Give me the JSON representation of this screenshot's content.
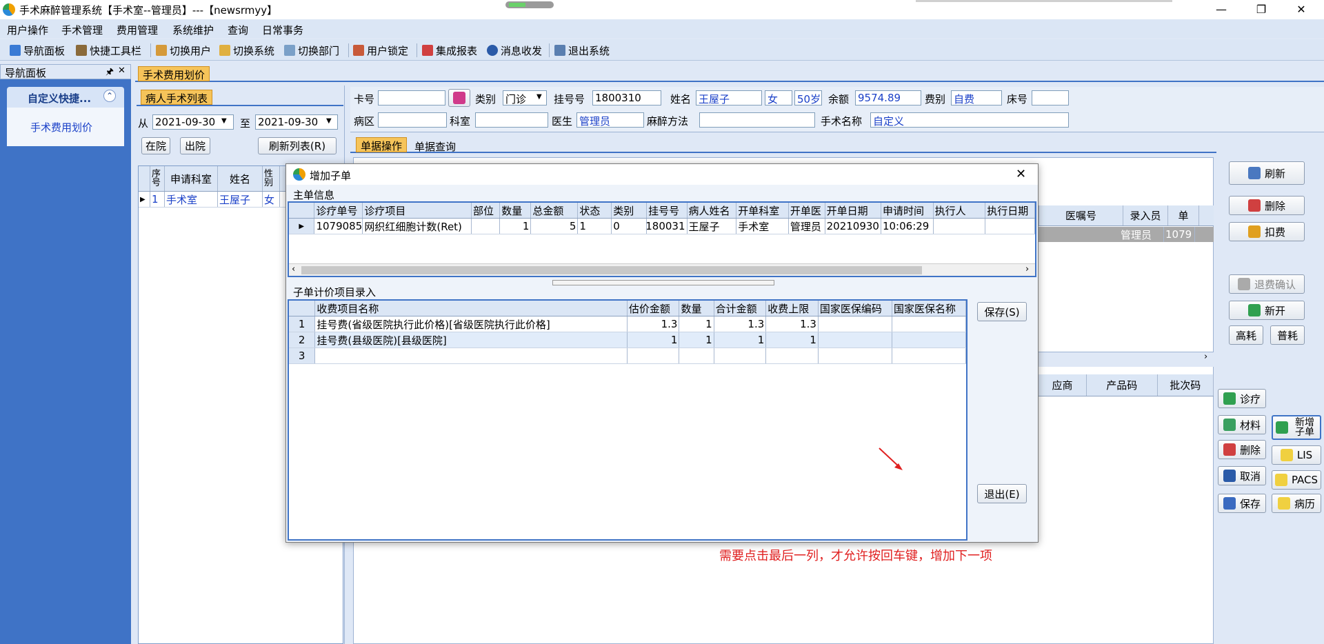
{
  "window": {
    "title": "手术麻醉管理系统【手术室--管理员】---【newsrmyy】",
    "minimize": "—",
    "maximize": "❐",
    "close": "✕"
  },
  "menu": [
    "用户操作",
    "手术管理",
    "费用管理",
    "系统维护",
    "查询",
    "日常事务"
  ],
  "toolbar": [
    "导航面板",
    "快捷工具栏",
    "切换用户",
    "切换系统",
    "切换部门",
    "用户锁定",
    "集成报表",
    "消息收发",
    "退出系统"
  ],
  "nav": {
    "title": "导航面板",
    "pin": "🖈",
    "close": "✕",
    "group_title": "自定义快捷...",
    "collapse": "⌃",
    "item": "手术费用划价"
  },
  "tab": {
    "label": "手术费用划价"
  },
  "patient_list": {
    "title": "病人手术列表",
    "from_label": "从",
    "from_date": "2021-09-30",
    "to_label": "至",
    "to_date": "2021-09-30",
    "btn_in": "在院",
    "btn_out": "出院",
    "btn_refresh": "刷新列表(R)",
    "columns": [
      "序号",
      "申请科室",
      "姓名",
      "性别"
    ],
    "rows": [
      [
        "1",
        "手术室",
        "王屋子",
        "女"
      ]
    ]
  },
  "patient_info": {
    "card_label": "卡号",
    "card_value": "",
    "type_label": "类别",
    "type_value": "门诊",
    "reg_label": "挂号号",
    "reg_value": "1800310",
    "name_label": "姓名",
    "name_value": "王屋子",
    "sex_value": "女",
    "age_value": "50岁",
    "balance_label": "余额",
    "balance_value": "9574.89",
    "fee_label": "费别",
    "fee_value": "自费",
    "bed_label": "床号",
    "bed_value": "",
    "ward_label": "病区",
    "ward_value": "",
    "dept_label": "科室",
    "dept_value": "",
    "doctor_label": "医生",
    "doctor_value": "管理员",
    "anes_label": "麻醉方法",
    "anes_value": "",
    "surgery_label": "手术名称",
    "surgery_value": "自定义"
  },
  "subtabs": [
    "单据操作",
    "单据查询"
  ],
  "bg_grid": {
    "columns": [
      "医嘱号",
      "录入员",
      "单"
    ],
    "row": [
      "",
      "管理员",
      "1079"
    ],
    "columns2": [
      "应商",
      "产品码",
      "批次码"
    ]
  },
  "right_buttons": {
    "refresh": "刷新",
    "delete": "删除",
    "charge": "扣费",
    "refund_confirm": "退费确认",
    "new_open": "新开",
    "high_cost": "高耗",
    "normal_cost": "普耗",
    "diagnose": "诊疗",
    "material": "材料",
    "add_sub": "新增子单",
    "delete2": "删除",
    "lis": "LIS",
    "cancel": "取消",
    "pacs": "PACS",
    "save": "保存",
    "record": "病历"
  },
  "dialog": {
    "title": "增加子单",
    "close": "✕",
    "main_section": "主单信息",
    "main_columns": [
      "诊疗单号",
      "诊疗项目",
      "部位",
      "数量",
      "总金额",
      "状态",
      "类别",
      "挂号号",
      "病人姓名",
      "开单科室",
      "开单医",
      "开单日期",
      "申请时间",
      "执行人",
      "执行日期"
    ],
    "main_row": [
      "1079085:",
      "网织红细胞计数(Ret)",
      "",
      "1",
      "5",
      "1",
      "0",
      "180031",
      "王屋子",
      "手术室",
      "管理员",
      "20210930",
      "10:06:29",
      "",
      ""
    ],
    "sub_section": "子单计价项目录入",
    "sub_columns": [
      "收费项目名称",
      "估价金额",
      "数量",
      "合计金额",
      "收费上限",
      "国家医保编码",
      "国家医保名称"
    ],
    "sub_rows": [
      [
        "1",
        "挂号费(省级医院执行此价格)[省级医院执行此价格]",
        "1.3",
        "1",
        "1.3",
        "1.3",
        "",
        ""
      ],
      [
        "2",
        "挂号费(县级医院)[县级医院]",
        "1",
        "1",
        "1",
        "1",
        "",
        ""
      ],
      [
        "3",
        "",
        "",
        "",
        "",
        "",
        "",
        ""
      ]
    ],
    "save_btn": "保存(S)",
    "exit_btn": "退出(E)",
    "annotation": "需要点击最后一列，才允许按回车键，增加下一项"
  },
  "colors": {
    "accent": "#3f73c6",
    "tab": "#f6c45a",
    "annotation": "#e02020"
  }
}
